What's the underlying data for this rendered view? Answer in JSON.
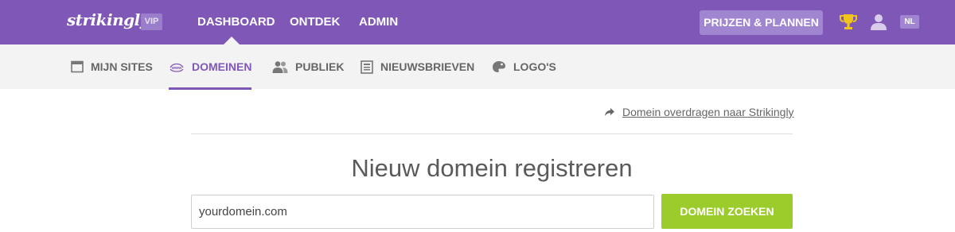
{
  "header": {
    "logo_text": "strikingly",
    "vip_badge": "VIP",
    "nav": [
      {
        "label": "DASHBOARD"
      },
      {
        "label": "ONTDEK"
      },
      {
        "label": "ADMIN"
      }
    ],
    "pricing_button": "PRIJZEN & PLANNEN",
    "language": "NL",
    "icons": [
      "trophy-icon",
      "user-icon"
    ]
  },
  "subnav": {
    "items": [
      {
        "label": "MIJN SITES",
        "icon": "browser-window-icon"
      },
      {
        "label": "DOMEINEN",
        "icon": "www-icon",
        "active": true
      },
      {
        "label": "PUBLIEK",
        "icon": "people-icon"
      },
      {
        "label": "NIEUWSBRIEVEN",
        "icon": "newsletter-icon"
      },
      {
        "label": "LOGO'S",
        "icon": "palette-icon"
      }
    ]
  },
  "main": {
    "transfer_link": "Domein overdragen naar Strikingly",
    "heading": "Nieuw domein registreren",
    "domain_input_value": "yourdomein.com",
    "search_button": "DOMEIN ZOEKEN"
  },
  "colors": {
    "brand_purple": "#7e57b7",
    "button_green": "#9ccc2c",
    "trophy_gold": "#f0c419"
  }
}
